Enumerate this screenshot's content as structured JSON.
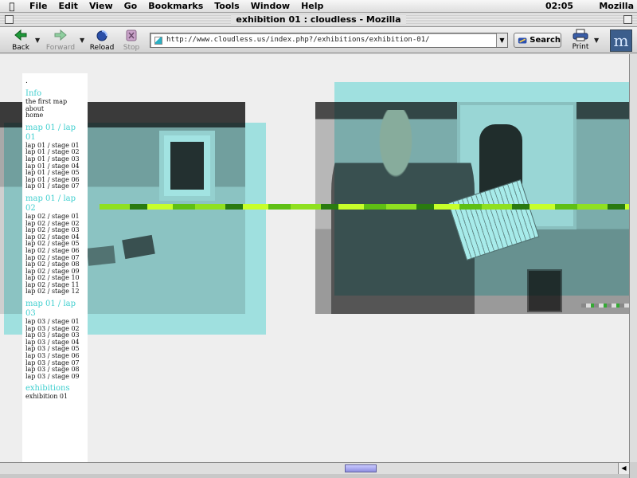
{
  "menubar": {
    "apple": "",
    "items": [
      "File",
      "Edit",
      "View",
      "Go",
      "Bookmarks",
      "Tools",
      "Window",
      "Help"
    ],
    "clock": "02:05",
    "app": "Mozilla"
  },
  "window": {
    "title": "exhibition 01 : cloudless - Mozilla"
  },
  "toolbar": {
    "back_label": "Back",
    "forward_label": "Forward",
    "reload_label": "Reload",
    "stop_label": "Stop",
    "url": "http://www.cloudless.us/index.php?/exhibitions/exhibition-01/",
    "search_label": "Search",
    "print_label": "Print",
    "logo": "m"
  },
  "sidebar": {
    "dot": ".",
    "sections": [
      {
        "heading": "Info",
        "items": [
          "the first map",
          "about",
          "home"
        ]
      },
      {
        "heading": "map 01 / lap 01",
        "items": [
          "lap 01 / stage 01",
          "lap 01 / stage 02",
          "lap 01 / stage 03",
          "lap 01 / stage 04",
          "lap 01 / stage 05",
          "lap 01 / stage 06",
          "lap 01 / stage 07"
        ]
      },
      {
        "heading": "map 01 / lap 02",
        "items": [
          "lap 02 / stage 01",
          "lap 02 / stage 02",
          "lap 02 / stage 03",
          "lap 02 / stage 04",
          "lap 02 / stage 05",
          "lap 02 / stage 06",
          "lap 02 / stage 07",
          "lap 02 / stage 08",
          "lap 02 / stage 09",
          "lap 02 / stage 10",
          "lap 02 / stage 11",
          "lap 02 / stage 12"
        ]
      },
      {
        "heading": "map 01 / lap 03",
        "items": [
          "lap 03 / stage 01",
          "lap 03 / stage 02",
          "lap 03 / stage 03",
          "lap 03 / stage 04",
          "lap 03 / stage 05",
          "lap 03 / stage 06",
          "lap 03 / stage 07",
          "lap 03 / stage 08",
          "lap 03 / stage 09"
        ]
      },
      {
        "heading": "exhibitions",
        "items": [
          "exhibition 01"
        ]
      }
    ]
  },
  "colors": {
    "accent": "#3fcfcf",
    "overlay": "#66e4e2",
    "glitch": "#8fe020"
  }
}
